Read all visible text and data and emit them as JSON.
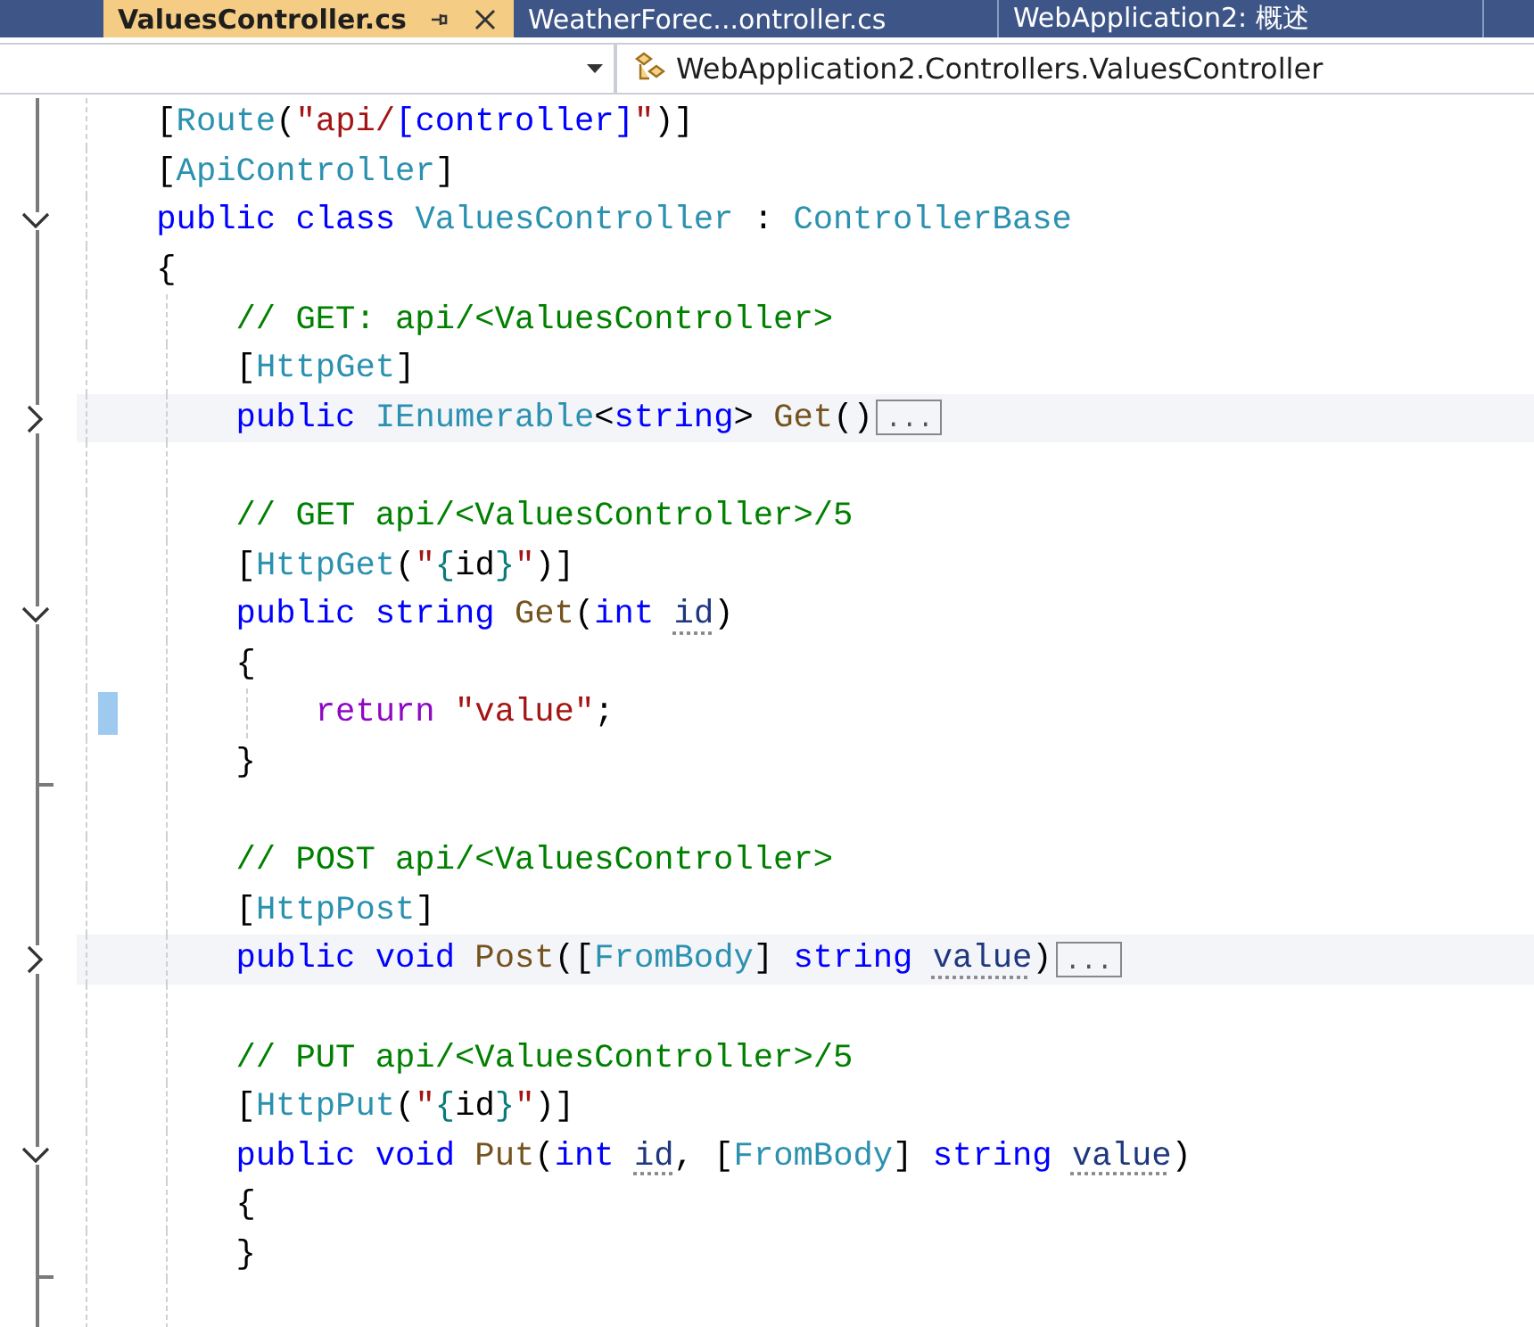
{
  "tabs": [
    {
      "label": "ValuesController.cs",
      "selected": true
    },
    {
      "label": "WeatherForec...ontroller.cs",
      "selected": false
    },
    {
      "label": "WebApplication2: 概述",
      "selected": false
    }
  ],
  "navigation_bar": {
    "member": "WebApplication2.Controllers.ValuesController"
  },
  "code_lines": [
    {
      "kind": "code",
      "tokens": [
        {
          "text": "    [",
          "kind": "plain"
        },
        {
          "text": "Route",
          "kind": "type"
        },
        {
          "text": "(",
          "kind": "plain"
        },
        {
          "text": "\"api/",
          "kind": "string"
        },
        {
          "text": "[controller]",
          "kind": "keyword"
        },
        {
          "text": "\"",
          "kind": "string"
        },
        {
          "text": ")]",
          "kind": "plain"
        }
      ]
    },
    {
      "kind": "code",
      "tokens": [
        {
          "text": "    [",
          "kind": "plain"
        },
        {
          "text": "ApiController",
          "kind": "type"
        },
        {
          "text": "]",
          "kind": "plain"
        }
      ]
    },
    {
      "kind": "code",
      "expanded": true,
      "tokens": [
        {
          "text": "    public class ",
          "kind": "keyword"
        },
        {
          "text": "ValuesController",
          "kind": "type"
        },
        {
          "text": " : ",
          "kind": "plain"
        },
        {
          "text": "ControllerBase",
          "kind": "type"
        }
      ]
    },
    {
      "kind": "code",
      "tokens": [
        {
          "text": "    {",
          "kind": "plain"
        }
      ]
    },
    {
      "kind": "code",
      "tokens": [
        {
          "text": "        // GET: api/<ValuesController>",
          "kind": "comment"
        }
      ]
    },
    {
      "kind": "code",
      "tokens": [
        {
          "text": "        [",
          "kind": "plain"
        },
        {
          "text": "HttpGet",
          "kind": "type"
        },
        {
          "text": "]",
          "kind": "plain"
        }
      ]
    },
    {
      "kind": "code",
      "expanded": false,
      "tokens": [
        {
          "text": "        public ",
          "kind": "keyword"
        },
        {
          "text": "IEnumerable",
          "kind": "type"
        },
        {
          "text": "<",
          "kind": "plain"
        },
        {
          "text": "string",
          "kind": "keyword"
        },
        {
          "text": "> ",
          "kind": "plain"
        },
        {
          "text": "Get",
          "kind": "method"
        },
        {
          "text": "()",
          "kind": "plain"
        }
      ],
      "collapsed": "..."
    },
    {
      "kind": "blank"
    },
    {
      "kind": "code",
      "tokens": [
        {
          "text": "        // GET api/<ValuesController>/5",
          "kind": "comment"
        }
      ]
    },
    {
      "kind": "code",
      "tokens": [
        {
          "text": "        [",
          "kind": "plain"
        },
        {
          "text": "HttpGet",
          "kind": "type"
        },
        {
          "text": "(",
          "kind": "plain"
        },
        {
          "text": "\"",
          "kind": "string"
        },
        {
          "text": "{",
          "kind": "brace"
        },
        {
          "text": "id",
          "kind": "plain"
        },
        {
          "text": "}",
          "kind": "brace"
        },
        {
          "text": "\"",
          "kind": "string"
        },
        {
          "text": ")]",
          "kind": "plain"
        }
      ]
    },
    {
      "kind": "code",
      "expanded": true,
      "tokens": [
        {
          "text": "        public string ",
          "kind": "keyword"
        },
        {
          "text": "Get",
          "kind": "method"
        },
        {
          "text": "(",
          "kind": "plain"
        },
        {
          "text": "int ",
          "kind": "keyword"
        },
        {
          "text": "id",
          "kind": "param"
        },
        {
          "text": ")",
          "kind": "plain"
        }
      ]
    },
    {
      "kind": "code",
      "tokens": [
        {
          "text": "        {",
          "kind": "plain"
        }
      ]
    },
    {
      "kind": "code",
      "changed": true,
      "tokens": [
        {
          "text": "            return ",
          "kind": "control"
        },
        {
          "text": "\"value\"",
          "kind": "string"
        },
        {
          "text": ";",
          "kind": "plain"
        }
      ]
    },
    {
      "kind": "code",
      "block_end": true,
      "tokens": [
        {
          "text": "        }",
          "kind": "plain"
        }
      ]
    },
    {
      "kind": "blank"
    },
    {
      "kind": "code",
      "tokens": [
        {
          "text": "        // POST api/<ValuesController>",
          "kind": "comment"
        }
      ]
    },
    {
      "kind": "code",
      "tokens": [
        {
          "text": "        [",
          "kind": "plain"
        },
        {
          "text": "HttpPost",
          "kind": "type"
        },
        {
          "text": "]",
          "kind": "plain"
        }
      ]
    },
    {
      "kind": "code",
      "expanded": false,
      "tokens": [
        {
          "text": "        public void ",
          "kind": "keyword"
        },
        {
          "text": "Post",
          "kind": "method"
        },
        {
          "text": "([",
          "kind": "plain"
        },
        {
          "text": "FromBody",
          "kind": "type"
        },
        {
          "text": "] ",
          "kind": "plain"
        },
        {
          "text": "string ",
          "kind": "keyword"
        },
        {
          "text": "value",
          "kind": "param"
        },
        {
          "text": ")",
          "kind": "plain"
        }
      ],
      "collapsed": "..."
    },
    {
      "kind": "blank"
    },
    {
      "kind": "code",
      "tokens": [
        {
          "text": "        // PUT api/<ValuesController>/5",
          "kind": "comment"
        }
      ]
    },
    {
      "kind": "code",
      "tokens": [
        {
          "text": "        [",
          "kind": "plain"
        },
        {
          "text": "HttpPut",
          "kind": "type"
        },
        {
          "text": "(",
          "kind": "plain"
        },
        {
          "text": "\"",
          "kind": "string"
        },
        {
          "text": "{",
          "kind": "brace"
        },
        {
          "text": "id",
          "kind": "plain"
        },
        {
          "text": "}",
          "kind": "brace"
        },
        {
          "text": "\"",
          "kind": "string"
        },
        {
          "text": ")]",
          "kind": "plain"
        }
      ]
    },
    {
      "kind": "code",
      "expanded": true,
      "tokens": [
        {
          "text": "        public void ",
          "kind": "keyword"
        },
        {
          "text": "Put",
          "kind": "method"
        },
        {
          "text": "(",
          "kind": "plain"
        },
        {
          "text": "int ",
          "kind": "keyword"
        },
        {
          "text": "id",
          "kind": "param"
        },
        {
          "text": ", [",
          "kind": "plain"
        },
        {
          "text": "FromBody",
          "kind": "type"
        },
        {
          "text": "] ",
          "kind": "plain"
        },
        {
          "text": "string ",
          "kind": "keyword"
        },
        {
          "text": "value",
          "kind": "param"
        },
        {
          "text": ")",
          "kind": "plain"
        }
      ]
    },
    {
      "kind": "code",
      "tokens": [
        {
          "text": "        {",
          "kind": "plain"
        }
      ]
    },
    {
      "kind": "code",
      "block_end": true,
      "tokens": [
        {
          "text": "        }",
          "kind": "plain"
        }
      ]
    },
    {
      "kind": "blank"
    }
  ]
}
